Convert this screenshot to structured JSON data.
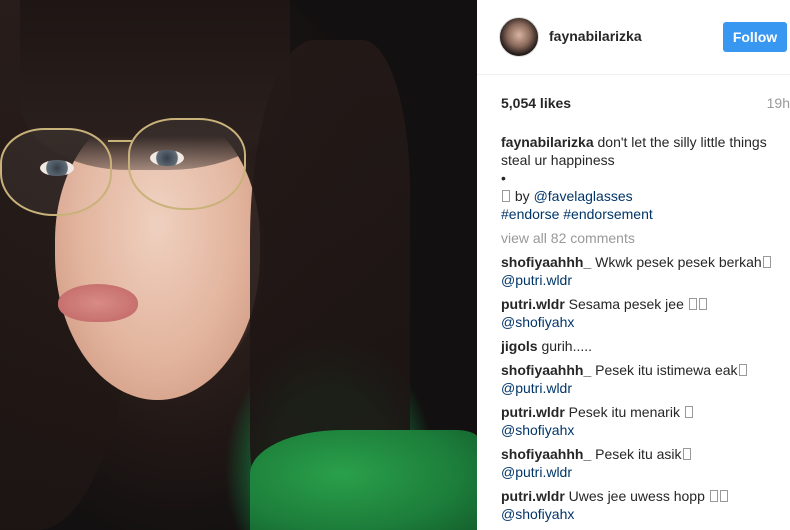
{
  "post": {
    "username": "faynabilarizka",
    "follow_label": "Follow",
    "likes": "5,054 likes",
    "time": "19h",
    "caption": {
      "user": "faynabilarizka",
      "text": "don't let the silly little things steal ur happiness",
      "bullet": "•",
      "by_text": "by",
      "by_mention": "@favelaglasses",
      "hashtags": "#endorse #endorsement"
    },
    "view_all": "view all 82 comments"
  },
  "comments": [
    {
      "user": "shofiyaahhh_",
      "text": "Wkwk pesek pesek berkah",
      "mention": "@putri.wldr"
    },
    {
      "user": "putri.wldr",
      "text": "Sesama pesek jee",
      "mention": "@shofiyahx"
    },
    {
      "user": "jigols",
      "text": "gurih.....",
      "mention": ""
    },
    {
      "user": "shofiyaahhh_",
      "text": "Pesek itu istimewa eak",
      "mention": "@putri.wldr"
    },
    {
      "user": "putri.wldr",
      "text": "Pesek itu menarik",
      "mention": "@shofiyahx"
    },
    {
      "user": "shofiyaahhh_",
      "text": "Pesek itu asik",
      "mention": "@putri.wldr"
    },
    {
      "user": "putri.wldr",
      "text": "Uwes jee uwess hopp",
      "mention": "@shofiyahx"
    }
  ],
  "colors": {
    "accent": "#3897f0",
    "link": "#003569",
    "muted": "#999999"
  }
}
